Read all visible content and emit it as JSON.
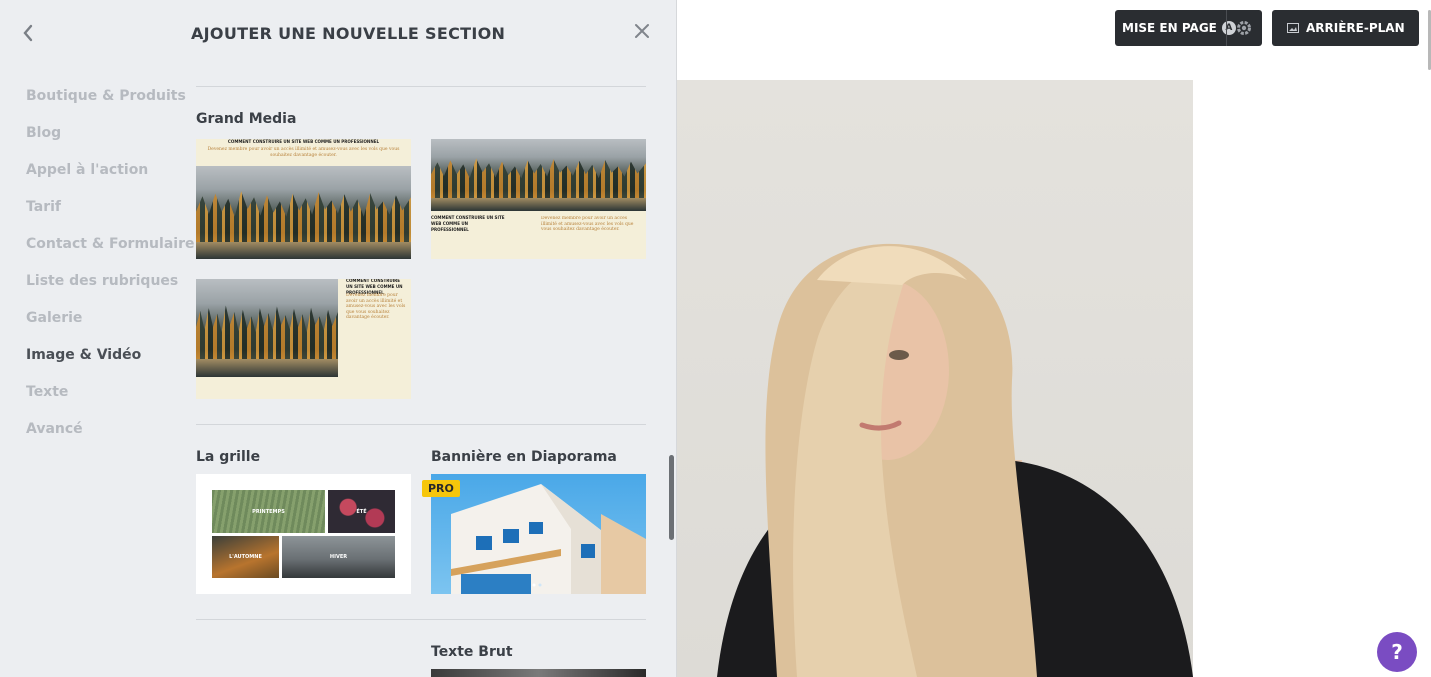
{
  "panel": {
    "title": "AJOUTER UNE NOUVELLE SECTION",
    "back_icon": "chevron-left-icon",
    "close_icon": "close-icon",
    "categories": [
      {
        "label": "Boutique & Produits",
        "active": false
      },
      {
        "label": "Blog",
        "active": false
      },
      {
        "label": "Appel à l'action",
        "active": false
      },
      {
        "label": "Tarif",
        "active": false
      },
      {
        "label": "Contact & Formulaire",
        "active": false
      },
      {
        "label": "Liste des rubriques",
        "active": false
      },
      {
        "label": "Galerie",
        "active": false
      },
      {
        "label": "Image & Vidéo",
        "active": true
      },
      {
        "label": "Texte",
        "active": false
      },
      {
        "label": "Avancé",
        "active": false
      }
    ],
    "sections": {
      "grand_media": {
        "title": "Grand Media",
        "sample_heading": "COMMENT CONSTRUIRE UN SITE WEB COMME UN PROFESSIONNEL",
        "sample_text": "Devenez membre pour avoir un accès illimité et amusez-vous avec les vols que vous souhaitez davantage écouter."
      },
      "la_grille": {
        "title": "La grille",
        "cells": [
          "PRINTEMPS",
          "ÉTÉ",
          "L'AUTOMNE",
          "HIVER"
        ]
      },
      "banniere": {
        "title": "Bannière en Diaporama",
        "badge": "PRO"
      },
      "texte_brut": {
        "title": "Texte Brut"
      }
    }
  },
  "toolbar": {
    "layout_label": "MISE EN PAGE",
    "layout_badge": "A",
    "settings_icon": "gear-icon",
    "background_icon": "image-icon",
    "background_label": "ARRIÈRE-PLAN"
  },
  "help": {
    "label": "?"
  },
  "colors": {
    "accent_help": "#7a4cc2",
    "pro_badge": "#f6c60b",
    "toolbar_btn": "#2a2d31"
  }
}
